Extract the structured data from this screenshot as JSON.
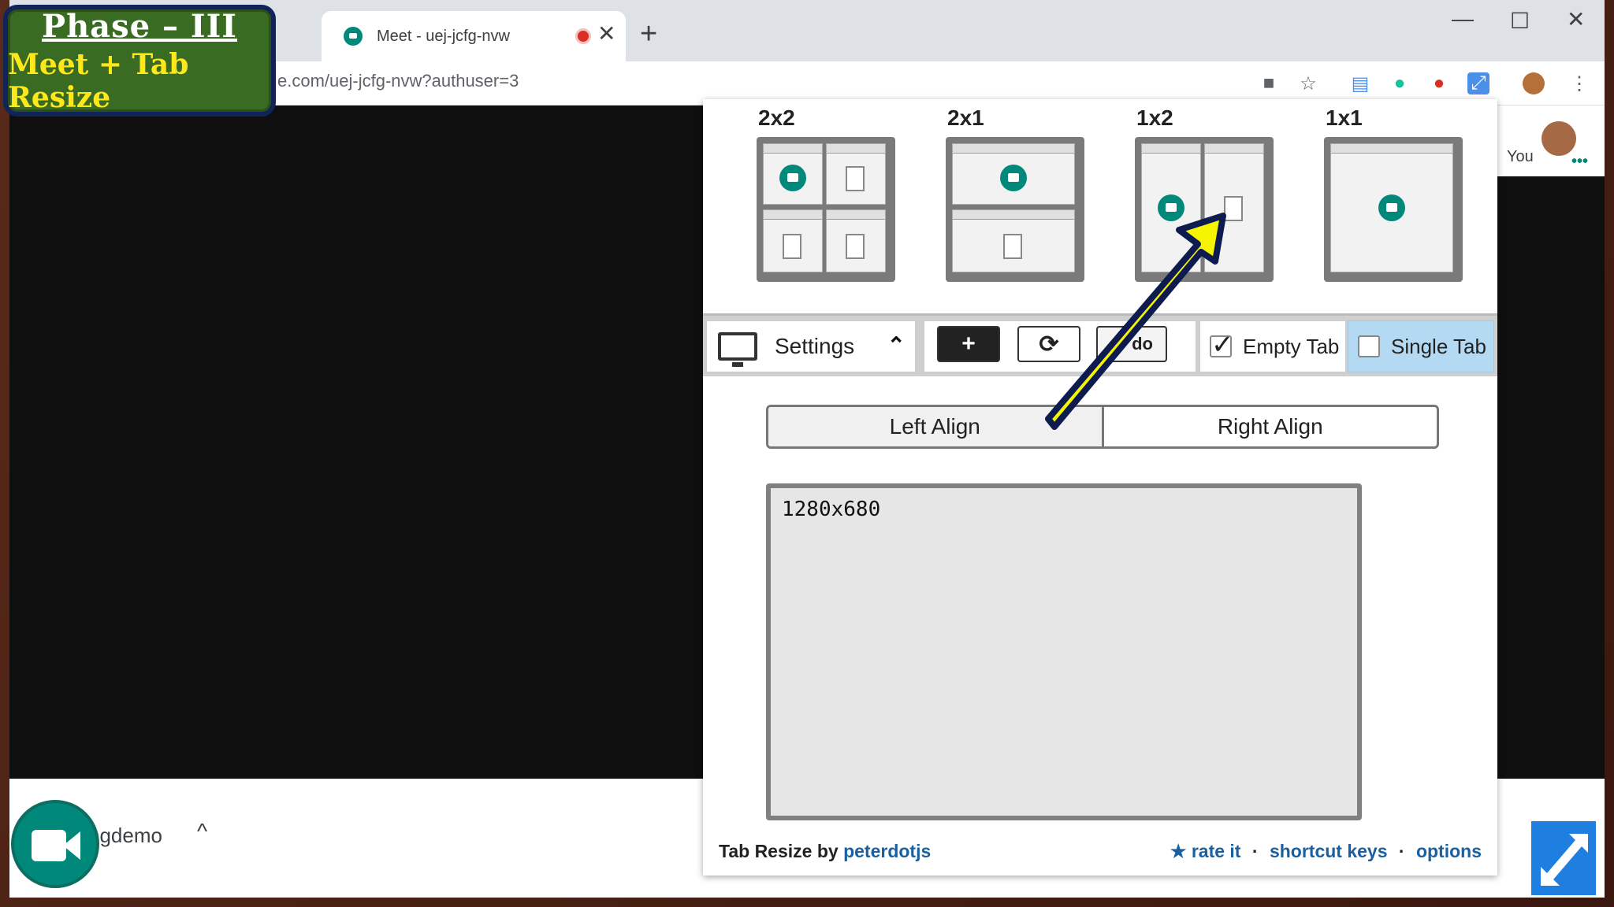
{
  "overlay": {
    "line1": "Phase – III",
    "line2": "Meet + Tab Resize"
  },
  "browser": {
    "active_tab_title": "Meet - uej-jcfg-nvw",
    "url": "e.com/uej-jcfg-nvw?authuser=3",
    "new_tab": "+",
    "close": "✕",
    "minimize": "—",
    "maximize": "☐",
    "window_close": "✕",
    "icons": [
      "camera-icon",
      "star-icon",
      "docs-icon",
      "grammarly-icon",
      "apple-icon",
      "tab-resize-icon",
      "avatar",
      "menu-icon"
    ]
  },
  "meet": {
    "you_label": "You",
    "meeting_name": "ngdemo",
    "caret": "^",
    "more": "•••"
  },
  "popup": {
    "layouts": [
      {
        "label": "2x2"
      },
      {
        "label": "2x1"
      },
      {
        "label": "1x2"
      },
      {
        "label": "1x1"
      }
    ],
    "settings_label": "Settings",
    "plus_label": "+",
    "refresh_label": "⟳",
    "undo_label": "do",
    "empty_tab_label": "Empty Tab",
    "empty_tab_checked": true,
    "single_tab_label": "Single Tab",
    "single_tab_checked": false,
    "left_align_label": "Left Align",
    "right_align_label": "Right Align",
    "resolution": "1280x680",
    "footer": {
      "prefix": "Tab Resize by ",
      "author": "peterdotjs",
      "rate": "★ rate it",
      "sep": "·",
      "shortcut": "shortcut keys",
      "options": "options"
    }
  },
  "colors": {
    "arrow_fill": "#f5f500",
    "arrow_stroke": "#0d1b4f",
    "meet_teal": "#00897b",
    "overlay_bg": "#3a6b22",
    "overlay_text": "#ffe81a"
  }
}
